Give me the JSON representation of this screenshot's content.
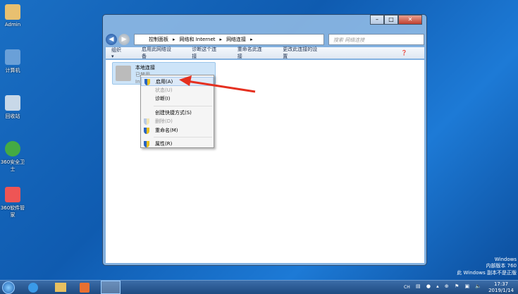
{
  "desktop": {
    "icons": [
      "Admin",
      "计算机",
      "回收站",
      "360安全卫士",
      "360软件管家"
    ]
  },
  "window": {
    "address": [
      "控制面板",
      "网络和 Internet",
      "网络连接"
    ],
    "search_placeholder": "搜索 网络连接",
    "toolbar": [
      "组织 ▾",
      "启用此网络设备",
      "诊断这个连接",
      "重命名此连接",
      "更改此连接的设置"
    ],
    "connection": {
      "name": "本地连接",
      "status": "已禁用",
      "adapter": "Intel"
    }
  },
  "context_menu": [
    {
      "label": "启用(A)",
      "state": "highlighted"
    },
    {
      "label": "状态(U)",
      "state": "disabled"
    },
    {
      "label": "诊断(I)",
      "state": "normal"
    },
    {
      "label": "创建快捷方式(S)",
      "state": "normal"
    },
    {
      "label": "删除(D)",
      "state": "disabled"
    },
    {
      "label": "重命名(M)",
      "state": "normal"
    },
    {
      "label": "属性(R)",
      "state": "normal"
    }
  ],
  "watermark": [
    "Windows",
    "内部版本 760",
    "此 Windows 副本不是正版"
  ],
  "clock": {
    "time": "17:37",
    "date": "2019/1/14"
  },
  "tray": {
    "ime": "CH"
  }
}
